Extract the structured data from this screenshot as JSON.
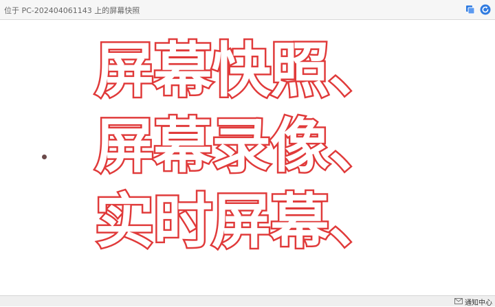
{
  "window": {
    "title": "位于 PC-202404061143 上的屏幕快照"
  },
  "toolbar": {
    "copy_icon": "copy-icon",
    "refresh_icon": "refresh-icon",
    "accent_color": "#2f7be0"
  },
  "content": {
    "lines": [
      "屏幕快照、",
      "屏幕录像、",
      "实时屏幕、"
    ],
    "text_fill": "#ffffff",
    "text_stroke": "#e03a3a"
  },
  "statusbar": {
    "notification_label": "通知中心",
    "mail_icon": "mail-icon"
  }
}
